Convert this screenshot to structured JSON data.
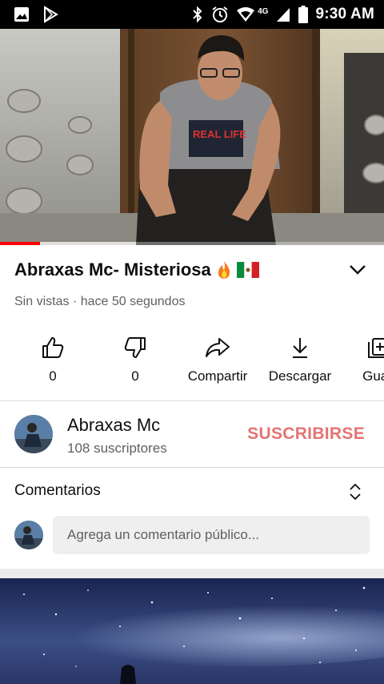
{
  "status_bar": {
    "time": "9:30 AM",
    "network_label": "4G",
    "left_icons": [
      "image-icon",
      "play-store-icon"
    ],
    "right_icons": [
      "bluetooth-icon",
      "alarm-icon",
      "wifi-icon",
      "signal-icon",
      "battery-icon"
    ]
  },
  "player": {
    "progress_fraction": 0.105,
    "buffered_fraction": 0.355
  },
  "video": {
    "title": "Abraxas Mc- Misteriosa",
    "title_emojis": [
      "fire",
      "mexico-flag"
    ],
    "views": "Sin vistas",
    "separator": "·",
    "age": "hace 50 segundos"
  },
  "actions": [
    {
      "name": "like",
      "label": "0",
      "icon": "thumb-up-icon"
    },
    {
      "name": "dislike",
      "label": "0",
      "icon": "thumb-down-icon"
    },
    {
      "name": "share",
      "label": "Compartir",
      "icon": "share-icon"
    },
    {
      "name": "download",
      "label": "Descargar",
      "icon": "download-icon"
    },
    {
      "name": "save",
      "label": "Guar",
      "icon": "playlist-add-icon"
    }
  ],
  "channel": {
    "name": "Abraxas Mc",
    "subscribers": "108 suscriptores",
    "subscribe_label": "SUSCRIBIRSE",
    "subscribe_color": "#e57373"
  },
  "comments": {
    "title": "Comentarios",
    "placeholder": "Agrega un comentario público..."
  },
  "colors": {
    "accent": "#ff0000",
    "text_secondary": "#606060"
  }
}
